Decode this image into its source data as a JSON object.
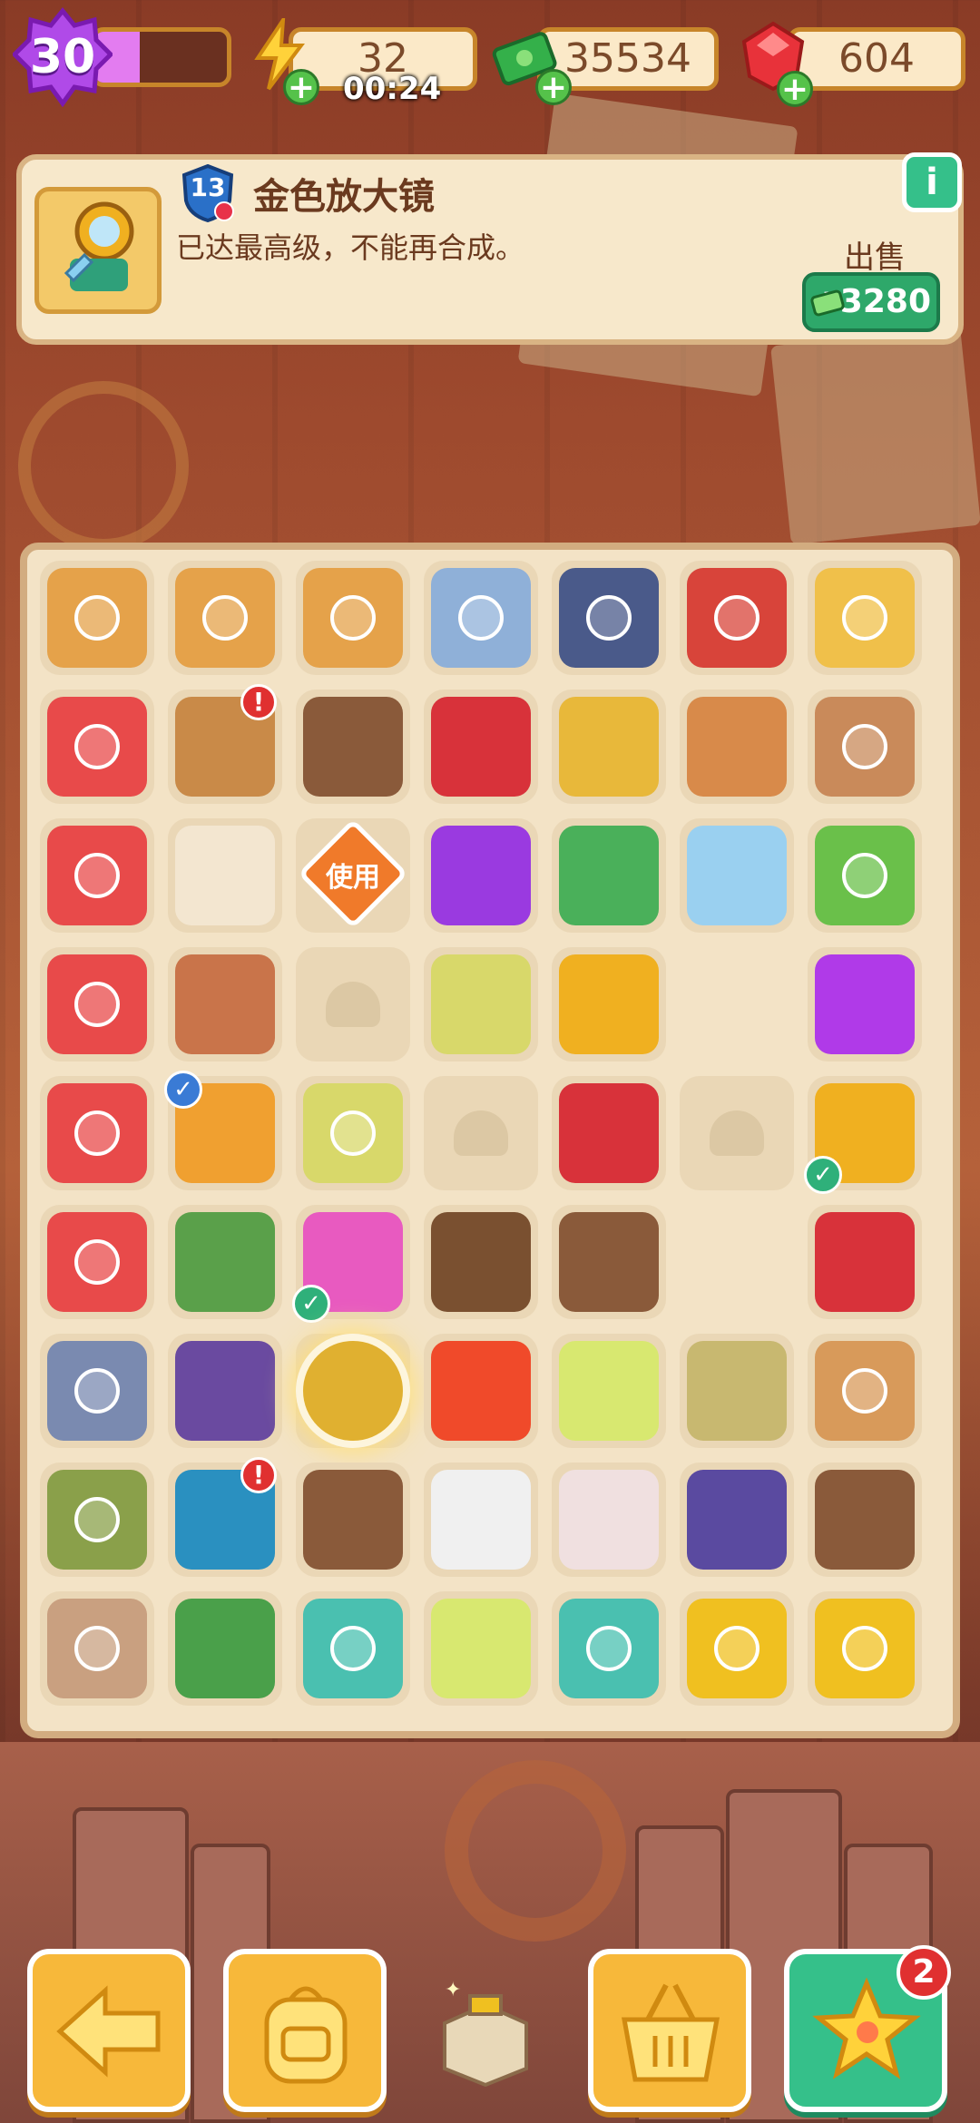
{
  "hud": {
    "level": "30",
    "xp_progress": 0.34,
    "energy": "32",
    "energy_timer": "00:24",
    "cash": "35534",
    "gems": "604"
  },
  "item_info": {
    "name": "金色放大镜",
    "level": "13",
    "description": "已达最高级，不能再合成。",
    "sell_label": "出售",
    "sell_price": "+3280",
    "info_icon": "i"
  },
  "board": {
    "use_label": "使用",
    "cells": [
      {
        "icon": "moving-boxes-icon",
        "color": "#e5a24a",
        "ring": true
      },
      {
        "icon": "moving-boxes-icon",
        "color": "#e5a24a",
        "ring": true
      },
      {
        "icon": "moving-boxes-icon",
        "color": "#e5a24a",
        "ring": true
      },
      {
        "icon": "kid-character-icon",
        "color": "#8fb0d8",
        "ring": true
      },
      {
        "icon": "jeep-icon",
        "color": "#4a5a8a",
        "ring": true
      },
      {
        "icon": "dragon-vase-icon",
        "color": "#d8443a",
        "ring": true
      },
      {
        "icon": "golden-mirror-icon",
        "color": "#f0c04a",
        "ring": true
      },
      {
        "icon": "washing-machine-icon",
        "color": "#e84a4a",
        "ring": true
      },
      {
        "icon": "treasure-chest-icon",
        "color": "#c98a48",
        "badge": "!"
      },
      {
        "icon": "brown-folders-icon",
        "color": "#8a5a3a"
      },
      {
        "icon": "red-gloves-icon",
        "color": "#d8323a"
      },
      {
        "icon": "seeds-icon",
        "color": "#e8b83a"
      },
      {
        "icon": "clay-pot-icon",
        "color": "#d88a4a"
      },
      {
        "icon": "portrait-frame-icon",
        "color": "#c98a5a",
        "ring": true
      },
      {
        "icon": "washing-machine-icon",
        "color": "#e84a4a",
        "ring": true
      },
      {
        "icon": "wood-blocks-icon",
        "color": "#f3e6d0"
      },
      {
        "icon": "use-ticket-icon",
        "color": "#f07a2a",
        "use": true
      },
      {
        "icon": "purple-flower-icon",
        "color": "#9a3ae0"
      },
      {
        "icon": "green-comb-icon",
        "color": "#4ab05a"
      },
      {
        "icon": "glass-table-icon",
        "color": "#9ad0f0"
      },
      {
        "icon": "potted-plant-icon",
        "color": "#6ac04a",
        "ring": true
      },
      {
        "icon": "red-robot-icon",
        "color": "#e84a4a",
        "ring": true
      },
      {
        "icon": "small-pot-icon",
        "color": "#c9744a"
      },
      {
        "icon": "empty-slot-icon",
        "color": "",
        "empty": true
      },
      {
        "icon": "seed-bag-icon",
        "color": "#d8d86a"
      },
      {
        "icon": "yellow-cup-icon",
        "color": "#f0b020"
      },
      {
        "icon": "empty-slot-icon",
        "color": "",
        "blank": true
      },
      {
        "icon": "purple-gem-icon",
        "color": "#b03ae8"
      },
      {
        "icon": "red-robot-icon",
        "color": "#e84a4a",
        "ring": true
      },
      {
        "icon": "juice-box-icon",
        "color": "#f0a030",
        "check": "blue"
      },
      {
        "icon": "seed-bag-icon",
        "color": "#d8d86a",
        "ring": true
      },
      {
        "icon": "empty-slot-icon",
        "color": "",
        "empty": true
      },
      {
        "icon": "red-gloves-icon",
        "color": "#d8323a"
      },
      {
        "icon": "empty-slot-icon",
        "color": "",
        "empty": true
      },
      {
        "icon": "golden-magnifier-icon",
        "color": "#f0b020",
        "check": "green"
      },
      {
        "icon": "red-robot-icon",
        "color": "#e84a4a",
        "ring": true
      },
      {
        "icon": "bonsai-icon",
        "color": "#5aa04a"
      },
      {
        "icon": "flower-basket-icon",
        "color": "#e85ac0",
        "check": "green"
      },
      {
        "icon": "sprout-icon",
        "color": "#7a5030"
      },
      {
        "icon": "leaf-scraps-icon",
        "color": "#8a5a3a"
      },
      {
        "icon": "empty-slot-icon",
        "color": "",
        "blank": true
      },
      {
        "icon": "red-gloves-icon",
        "color": "#d8323a"
      },
      {
        "icon": "mixer-icon",
        "color": "#7a8ab0",
        "ring": true
      },
      {
        "icon": "bicycle-icon",
        "color": "#6a4aa0"
      },
      {
        "icon": "trophy-icon",
        "color": "#e0b030",
        "glow": true
      },
      {
        "icon": "energy-orb-icon",
        "color": "#f04a2a"
      },
      {
        "icon": "spray-bottle-icon",
        "color": "#d8e870"
      },
      {
        "icon": "cloth-scraps-icon",
        "color": "#c8b870"
      },
      {
        "icon": "potted-plant-icon",
        "color": "#d89a5a",
        "ring": true
      },
      {
        "icon": "fountain-icon",
        "color": "#8aa04a",
        "ring": true
      },
      {
        "icon": "blue-chest-icon",
        "color": "#2a90c0",
        "badge": "!"
      },
      {
        "icon": "leaf-outline-icon",
        "color": "#8a5a3a"
      },
      {
        "icon": "white-glove-icon",
        "color": "#f0f0f0"
      },
      {
        "icon": "white-gloves-icon",
        "color": "#f0e0e0"
      },
      {
        "icon": "wheels-icon",
        "color": "#5a4aa0"
      },
      {
        "icon": "brown-folders-icon",
        "color": "#8a5a3a"
      },
      {
        "icon": "bathtub-house-icon",
        "color": "#c9a080",
        "ring": true
      },
      {
        "icon": "cabbage-icon",
        "color": "#4aa04a"
      },
      {
        "icon": "first-aid-bottles-icon",
        "color": "#4ac0b0",
        "ring": true
      },
      {
        "icon": "spray-bottle-icon",
        "color": "#d8e870"
      },
      {
        "icon": "first-aid-bottles-icon",
        "color": "#4ac0b0",
        "ring": true
      },
      {
        "icon": "toolbox-icon",
        "color": "#f0c020",
        "ring": true
      },
      {
        "icon": "toolbox-icon",
        "color": "#f0c020",
        "ring": true
      }
    ]
  },
  "toolbar": {
    "star_badge": "2"
  }
}
